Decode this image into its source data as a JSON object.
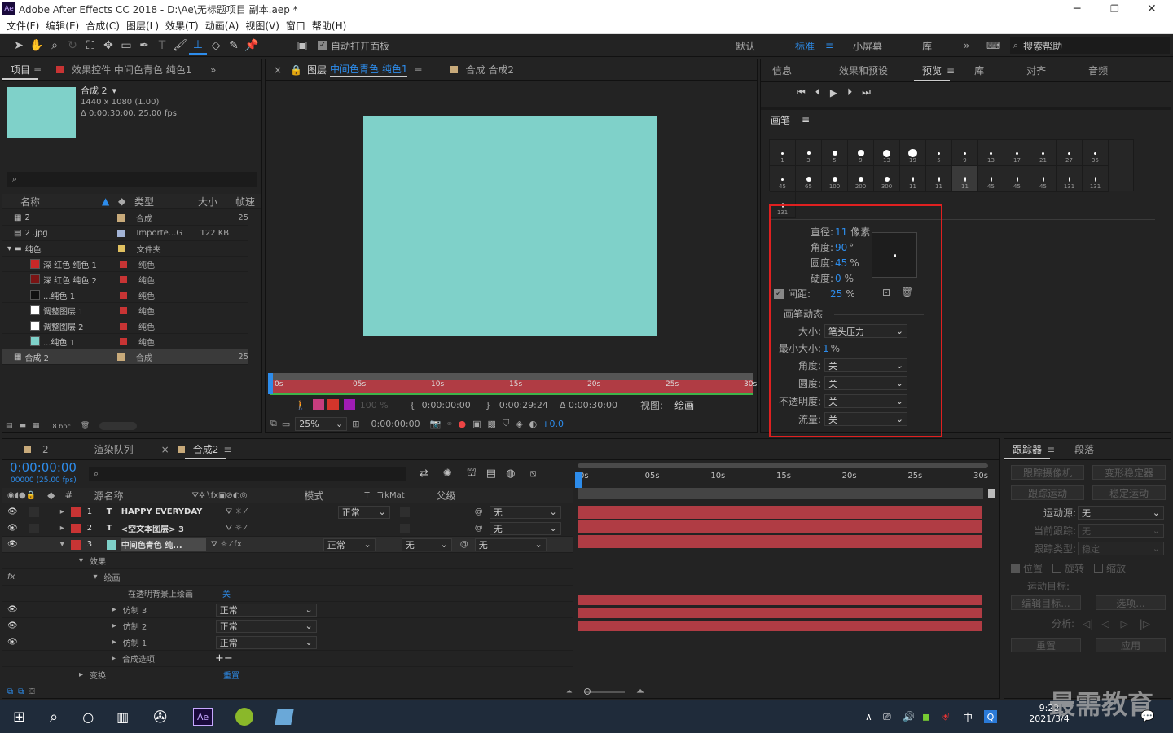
{
  "app": {
    "title": "Adobe After Effects CC 2018 - D:\\Ae\\无标题项目 副本.aep *",
    "icon": "Ae"
  },
  "menu": [
    "文件(F)",
    "编辑(E)",
    "合成(C)",
    "图层(L)",
    "效果(T)",
    "动画(A)",
    "视图(V)",
    "窗口",
    "帮助(H)"
  ],
  "toolbar": {
    "auto_open": "自动打开面板",
    "workspaces": [
      "默认",
      "标准",
      "小屏幕",
      "库"
    ],
    "search_placeholder": "搜索帮助"
  },
  "project": {
    "tabs": [
      "项目",
      "效果控件 中间色青色 纯色1"
    ],
    "comp_name": "合成 2",
    "comp_size": "1440 x 1080 (1.00)",
    "comp_duration": "Δ 0:00:30:00, 25.00 fps",
    "columns": [
      "名称",
      "类型",
      "大小",
      "帧速"
    ],
    "items": [
      {
        "name": "2",
        "type": "合成",
        "size": "",
        "fps": "25",
        "color": "#c8aa7a",
        "swatch": ""
      },
      {
        "name": "2 .jpg",
        "type": "Importe...G",
        "size": "122 KB",
        "fps": "",
        "color": "#a3b4d6",
        "swatch": ""
      },
      {
        "name": "纯色",
        "type": "文件夹",
        "size": "",
        "fps": "",
        "color": "#e0c060",
        "swatch": ""
      },
      {
        "name": "深 红色 纯色 1",
        "type": "纯色",
        "size": "",
        "fps": "",
        "color": "#c83434",
        "swatch": "#c82828"
      },
      {
        "name": "深 红色 纯色 2",
        "type": "纯色",
        "size": "",
        "fps": "",
        "color": "#c83434",
        "swatch": "#7a1414"
      },
      {
        "name": "...纯色 1",
        "type": "纯色",
        "size": "",
        "fps": "",
        "color": "#c83434",
        "swatch": "#111111"
      },
      {
        "name": "调整图层 1",
        "type": "纯色",
        "size": "",
        "fps": "",
        "color": "#c83434",
        "swatch": "#ffffff"
      },
      {
        "name": "调整图层 2",
        "type": "纯色",
        "size": "",
        "fps": "",
        "color": "#c83434",
        "swatch": "#ffffff"
      },
      {
        "name": "...纯色 1",
        "type": "纯色",
        "size": "",
        "fps": "",
        "color": "#c83434",
        "swatch": "#7fd1c9"
      },
      {
        "name": "合成 2",
        "type": "合成",
        "size": "",
        "fps": "25",
        "color": "#c8aa7a",
        "swatch": ""
      }
    ],
    "bpc": "8 bpc"
  },
  "viewer": {
    "tabs": [
      "图层",
      "中间色青色 纯色1",
      "合成 合成2"
    ],
    "ticks": [
      "0s",
      "05s",
      "10s",
      "15s",
      "20s",
      "25s",
      "30s"
    ],
    "zoom": "100 %",
    "in_time": "0:00:00:00",
    "out_time": "0:00:29:24",
    "duration": "Δ 0:00:30:00",
    "view_label": "视图:",
    "view_value": "绘画",
    "mag": "25%",
    "cur_time": "0:00:00:00",
    "exposure": "+0.0"
  },
  "right": {
    "tabs": [
      "信息",
      "效果和预设",
      "预览",
      "库",
      "对齐",
      "音频"
    ],
    "brush_title": "画笔",
    "brushes_row1": [
      "1",
      "3",
      "5",
      "9",
      "13",
      "19",
      "5",
      "9",
      "13",
      "17",
      "21",
      "27",
      "35",
      "45"
    ],
    "brushes_row2": [
      "65",
      "100",
      "200",
      "300",
      "11",
      "11",
      "11",
      "45",
      "45",
      "45",
      "131",
      "131",
      "131"
    ],
    "props": {
      "diameter_label": "直径:",
      "diameter": "11",
      "diameter_unit": "像素",
      "angle_label": "角度:",
      "angle": "90",
      "angle_unit": "°",
      "round_label": "圆度:",
      "round": "45",
      "round_unit": "%",
      "hard_label": "硬度:",
      "hard": "0",
      "hard_unit": "%",
      "spacing_label": "间距:",
      "spacing": "25",
      "spacing_unit": "%",
      "dynamics": "画笔动态",
      "size_label": "大小:",
      "size_val": "笔头压力",
      "minsize_label": "最小大小:",
      "minsize": "1",
      "minsize_unit": "%",
      "angle2_label": "角度:",
      "angle2": "关",
      "round2_label": "圆度:",
      "round2": "关",
      "opacity_label": "不透明度:",
      "opacity": "关",
      "flow_label": "流量:",
      "flow": "关"
    },
    "highlight_color": "#e02020"
  },
  "timeline": {
    "tabs": [
      "2",
      "渲染队列",
      "合成2"
    ],
    "timecode": "0:00:00:00",
    "fps_note": "00000 (25.00 fps)",
    "columns": [
      "源名称",
      "模式",
      "T",
      "TrkMat",
      "父级"
    ],
    "ticks": [
      "0s",
      "05s",
      "10s",
      "15s",
      "20s",
      "25s",
      "30s"
    ],
    "layers": [
      {
        "num": "1",
        "type": "T",
        "name": "HAPPY EVERYDAY",
        "mode": "正常",
        "trk": "",
        "parent": "无"
      },
      {
        "num": "2",
        "type": "T",
        "name": "<空文本图层> 3",
        "mode": "",
        "trk": "",
        "parent": "无"
      },
      {
        "num": "3",
        "type": "",
        "name": "中间色青色 纯...",
        "mode": "正常",
        "trk": "无",
        "parent": "无"
      }
    ],
    "sub": {
      "effects": "效果",
      "paint": "绘画",
      "paint_on_transparent": "在透明背景上绘画",
      "paint_on_transparent_val": "关",
      "clones": [
        {
          "name": "仿制 3",
          "mode": "正常"
        },
        {
          "name": "仿制 2",
          "mode": "正常"
        },
        {
          "name": "仿制 1",
          "mode": "正常"
        }
      ],
      "composite": "合成选项",
      "transform": "变换",
      "reset": "重置"
    }
  },
  "tracker": {
    "tabs": [
      "跟踪器",
      "段落"
    ],
    "track_camera": "跟踪摄像机",
    "warp": "变形稳定器",
    "track_motion": "跟踪运动",
    "stabilize": "稳定运动",
    "source_label": "运动源:",
    "source": "无",
    "current_label": "当前跟踪:",
    "current": "无",
    "type_label": "跟踪类型:",
    "type": "稳定",
    "position": "位置",
    "rotation": "旋转",
    "scale": "缩放",
    "target_label": "运动目标:",
    "edit_target": "编辑目标...",
    "options": "选项...",
    "analyze": "分析:",
    "reset": "重置",
    "apply": "应用"
  },
  "taskbar": {
    "time": "9:22",
    "date": "2021/3/4",
    "ime": "中",
    "watermark": "最需教育"
  }
}
